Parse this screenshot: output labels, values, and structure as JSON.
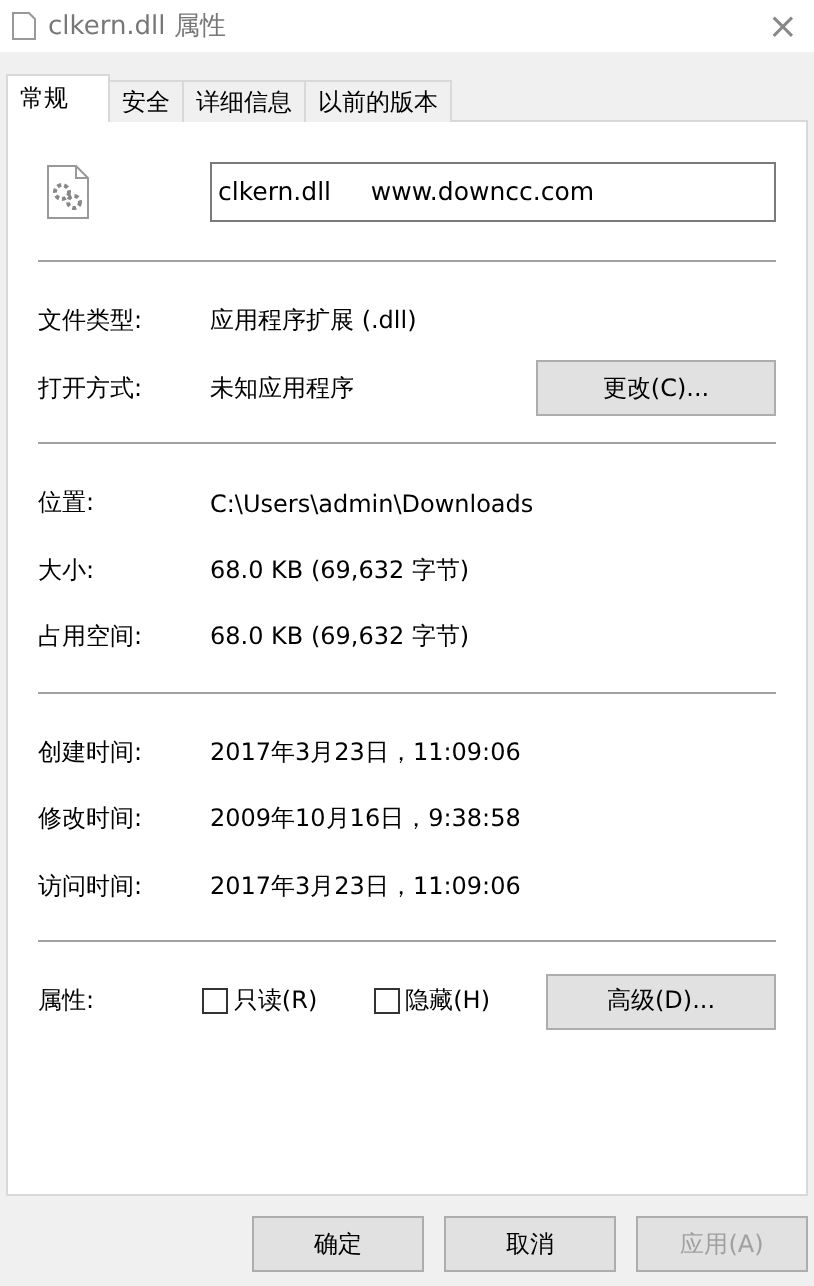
{
  "window": {
    "title": "clkern.dll 属性",
    "close": "×"
  },
  "tabs": [
    {
      "label": "常规",
      "selected": true
    },
    {
      "label": "安全",
      "selected": false
    },
    {
      "label": "详细信息",
      "selected": false
    },
    {
      "label": "以前的版本",
      "selected": false
    }
  ],
  "file_name": "clkern.dll     www.downcc.com",
  "sections": [
    [
      {
        "label": "文件类型:",
        "value": "应用程序扩展 (.dll)"
      },
      {
        "label": "打开方式:",
        "value": "未知应用程序",
        "button": "更改(C)..."
      }
    ],
    [
      {
        "label": "位置:",
        "value": "C:\\Users\\admin\\Downloads"
      },
      {
        "label": "大小:",
        "value": "68.0 KB (69,632 字节)"
      },
      {
        "label": "占用空间:",
        "value": "68.0 KB (69,632 字节)"
      }
    ],
    [
      {
        "label": "创建时间:",
        "value": "2017年3月23日，11:09:06"
      },
      {
        "label": "修改时间:",
        "value": "2009年10月16日，9:38:58"
      },
      {
        "label": "访问时间:",
        "value": "2017年3月23日，11:09:06"
      }
    ]
  ],
  "attributes": {
    "label": "属性:",
    "checkboxes": [
      {
        "label": "只读(R)",
        "checked": false
      },
      {
        "label": "隐藏(H)",
        "checked": false
      }
    ],
    "button": "高级(D)..."
  },
  "buttons": [
    {
      "label": "确定",
      "disabled": false
    },
    {
      "label": "取消",
      "disabled": false
    },
    {
      "label": "应用(A)",
      "disabled": true
    }
  ]
}
